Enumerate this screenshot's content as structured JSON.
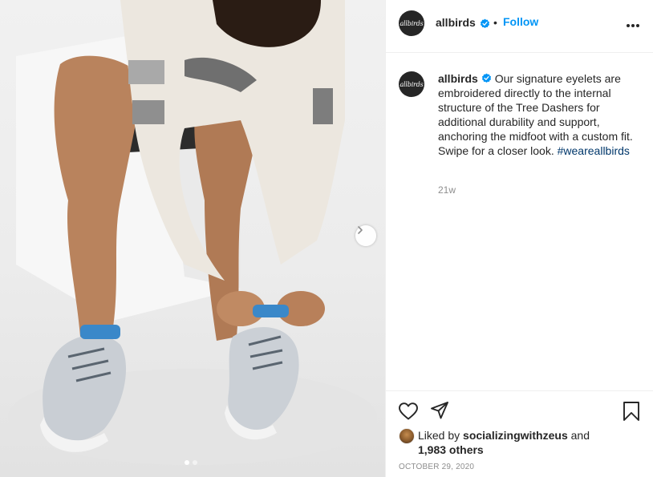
{
  "post": {
    "account": {
      "username": "allbirds",
      "avatar_text": "allbirds",
      "verified_icon": "verified-badge-icon",
      "separator": "•",
      "follow_label": "Follow"
    },
    "caption": {
      "username": "allbirds",
      "text": "Our signature eyelets are embroidered directly to the internal structure of the Tree Dashers for additional durability and support, anchoring the midfoot with a custom fit. Swipe for a closer look.",
      "hashtag": "#weareallbirds",
      "time_ago": "21w"
    },
    "media": {
      "next_icon": "chevron-right-icon",
      "carousel_count": 2,
      "carousel_active": 0
    },
    "actions": {
      "like_icon": "heart-icon",
      "share_icon": "paper-plane-icon",
      "save_icon": "bookmark-icon"
    },
    "likes": {
      "prefix": "Liked by",
      "user": "socializingwithzeus",
      "conjunction": "and",
      "others": "1,983 others"
    },
    "date": "OCTOBER 29, 2020"
  },
  "colors": {
    "accent": "#0095f6",
    "text": "#262626",
    "muted": "#8e8e8e",
    "hashtag": "#00376b",
    "border": "#efefef"
  }
}
